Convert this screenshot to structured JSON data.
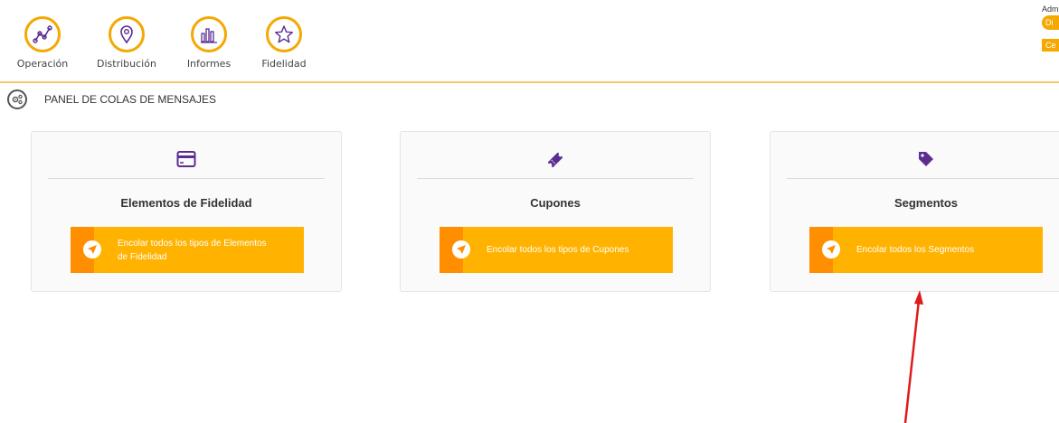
{
  "nav": {
    "items": [
      {
        "label": "Operación",
        "icon": "chart-line-icon"
      },
      {
        "label": "Distribución",
        "icon": "location-pin-icon"
      },
      {
        "label": "Informes",
        "icon": "bar-chart-icon"
      },
      {
        "label": "Fidelidad",
        "icon": "star-icon"
      }
    ]
  },
  "topright": {
    "user": "Adm",
    "badge1": "Di",
    "badge2": "Ce"
  },
  "panel": {
    "title": "PANEL DE COLAS DE MENSAJES",
    "icon": "cogs-icon"
  },
  "cards": [
    {
      "title": "Elementos de Fidelidad",
      "button": "Encolar todos los tipos de Elementos de Fidelidad",
      "icon": "credit-card-icon"
    },
    {
      "title": "Cupones",
      "button": "Encolar todos los tipos de Cupones",
      "icon": "ticket-icon"
    },
    {
      "title": "Segmentos",
      "button": "Encolar todos los Segmentos",
      "icon": "tag-icon"
    }
  ],
  "colors": {
    "accent": "#f5a800",
    "button": "#ffb300",
    "button_strip": "#ff8f00",
    "icon_purple": "#5b2d91",
    "annotation_arrow": "#e01b1b"
  }
}
